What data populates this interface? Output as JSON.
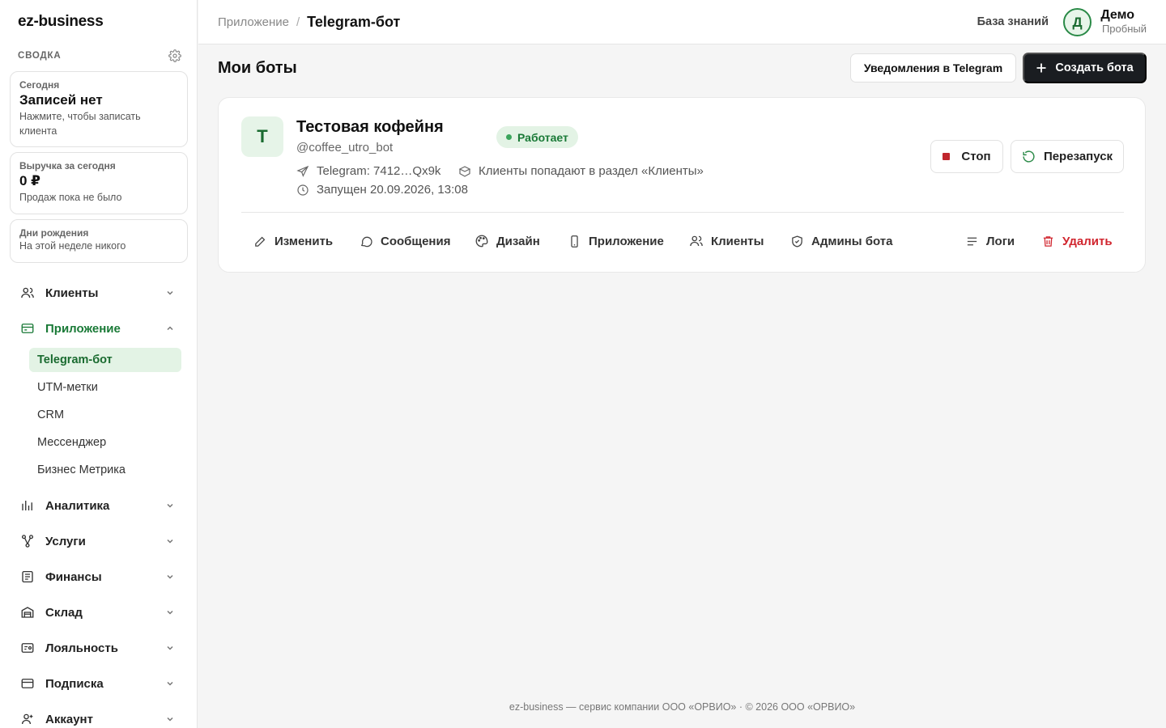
{
  "app": {
    "logo": "ez-business"
  },
  "sidebar": {
    "summary_label": "СВОДКА",
    "cards": [
      {
        "small": "Сегодня",
        "big": "Записей нет",
        "sub": "Нажмите, чтобы записать клиента"
      },
      {
        "small": "Выручка за сегодня",
        "big": "0 ₽",
        "sub": "Продаж пока не было"
      },
      {
        "small": "Дни рождения",
        "sub": "На этой неделе никого"
      }
    ],
    "nav": [
      {
        "label": "Клиенты"
      },
      {
        "label": "Приложение"
      },
      {
        "label": "Аналитика"
      },
      {
        "label": "Услуги"
      },
      {
        "label": "Финансы"
      },
      {
        "label": "Склад"
      },
      {
        "label": "Лояльность"
      },
      {
        "label": "Подписка"
      },
      {
        "label": "Аккаунт"
      }
    ],
    "subnav": [
      {
        "label": "Telegram-бот"
      },
      {
        "label": "UTM-метки"
      },
      {
        "label": "CRM"
      },
      {
        "label": "Мессенджер"
      },
      {
        "label": "Бизнес Метрика"
      }
    ]
  },
  "header": {
    "breadcrumb_parent": "Приложение",
    "breadcrumb_sep": "/",
    "breadcrumb_current": "Telegram-бот",
    "knowledge_base": "База знаний",
    "user_initial": "Д",
    "user_name": "Демо",
    "user_plan": "Пробный"
  },
  "main": {
    "title": "Мои боты",
    "notify_button": "Уведомления в Telegram",
    "create_button": "Создать бота"
  },
  "bot": {
    "initial": "Т",
    "name": "Тестовая кофейня",
    "handle": "@coffee_utro_bot",
    "status": "Работает",
    "token": "Telegram: 7412…Qx9k",
    "clients_note": "Клиенты попадают в раздел «Клиенты»",
    "started": "Запущен 20.09.2026, 13:08",
    "stop": "Стоп",
    "restart": "Перезапуск",
    "actions": {
      "edit": "Изменить",
      "messages": "Сообщения",
      "design": "Дизайн",
      "app": "Приложение",
      "clients": "Клиенты",
      "admins": "Админы бота",
      "logs": "Логи",
      "delete": "Удалить"
    }
  },
  "footer": "ez-business — сервис компании ООО «ОРВИО» · © 2026 ООО «ОРВИО»",
  "colors": {
    "accent": "#1a7a37",
    "danger": "#d1262f",
    "dark": "#1a1d21"
  }
}
